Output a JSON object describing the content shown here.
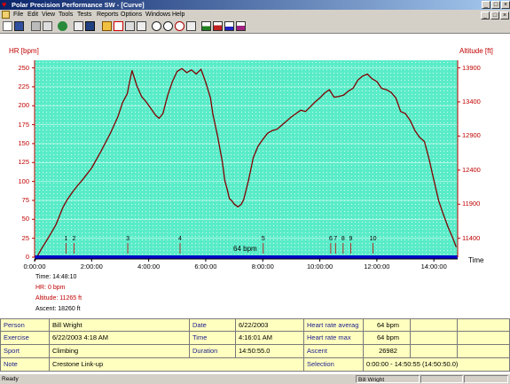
{
  "window": {
    "title": "Polar Precision Performance SW - [Curve]"
  },
  "menu": [
    "File",
    "Edit",
    "View",
    "Tools",
    "Tests",
    "Reports",
    "Options",
    "Windows",
    "Help"
  ],
  "colors": {
    "accent_red": "#c00000",
    "chart_bg": "#60f0d0",
    "blue_bar": "#0000c8",
    "table_bg": "#ffffc0"
  },
  "toolbar": [
    "new-icon",
    "save-icon",
    "print-icon",
    "print-preview-icon",
    "globe-icon",
    "calendar-icon",
    "book-icon",
    "folder-icon",
    "chart-icon",
    "calc-icon",
    "list-icon",
    "zoom-in-icon",
    "zoom-out-icon",
    "zoom-reset-icon",
    "bar-chart-1-icon",
    "bar-chart-2-icon",
    "bar-chart-3-icon",
    "bar-chart-4-icon"
  ],
  "chart_data": {
    "type": "line",
    "ylabel_left": "HR [bpm]",
    "ylabel_right": "Altitude [ft]",
    "xlabel": "Time",
    "hr_ticks": [
      0,
      25,
      50,
      75,
      100,
      125,
      150,
      175,
      200,
      225,
      250
    ],
    "altitude_ticks": [
      11400,
      11900,
      12400,
      12900,
      13400,
      13900
    ],
    "time_ticks": [
      "0:00:00",
      "2:00:00",
      "4:00:00",
      "6:00:00",
      "8:00:00",
      "10:00:00",
      "12:00:00",
      "14:00:00"
    ],
    "ylim_hr": [
      0,
      260
    ],
    "xlim_minutes": [
      0,
      890
    ],
    "baseline_label": "64 bpm",
    "lap_markers": [
      {
        "label": "1",
        "minutes": 66
      },
      {
        "label": "2",
        "minutes": 83
      },
      {
        "label": "3",
        "minutes": 196
      },
      {
        "label": "4",
        "minutes": 306
      },
      {
        "label": "5",
        "minutes": 481
      },
      {
        "label": "6",
        "minutes": 623
      },
      {
        "label": "7",
        "minutes": 633
      },
      {
        "label": "8",
        "minutes": 649
      },
      {
        "label": "9",
        "minutes": 665
      },
      {
        "label": "10",
        "minutes": 712
      }
    ],
    "series": [
      {
        "name": "Altitude",
        "x_minutes": [
          0,
          15,
          30,
          45,
          60,
          70,
          80,
          90,
          100,
          120,
          140,
          160,
          175,
          185,
          195,
          200,
          205,
          215,
          225,
          235,
          245,
          255,
          262,
          270,
          280,
          290,
          300,
          310,
          320,
          330,
          340,
          350,
          360,
          370,
          375,
          385,
          395,
          400,
          405,
          410,
          415,
          420,
          428,
          435,
          440,
          450,
          460,
          470,
          480,
          490,
          500,
          510,
          520,
          530,
          540,
          550,
          560,
          570,
          580,
          590,
          600,
          610,
          620,
          630,
          640,
          650,
          660,
          670,
          680,
          690,
          700,
          710,
          720,
          730,
          740,
          750,
          760,
          770,
          780,
          790,
          800,
          810,
          820,
          830,
          840,
          850,
          860,
          870,
          880,
          887
        ],
        "values_ft": [
          11065,
          11250,
          11420,
          11600,
          11860,
          11980,
          12080,
          12170,
          12250,
          12430,
          12680,
          12950,
          13180,
          13390,
          13520,
          13700,
          13860,
          13640,
          13480,
          13400,
          13300,
          13200,
          13160,
          13230,
          13500,
          13700,
          13850,
          13890,
          13830,
          13870,
          13810,
          13880,
          13690,
          13460,
          13220,
          12900,
          12520,
          12250,
          12120,
          11980,
          11950,
          11900,
          11860,
          11900,
          11970,
          12250,
          12580,
          12750,
          12850,
          12940,
          12980,
          13000,
          13060,
          13120,
          13180,
          13230,
          13280,
          13260,
          13330,
          13400,
          13460,
          13530,
          13580,
          13470,
          13480,
          13500,
          13560,
          13600,
          13720,
          13780,
          13810,
          13740,
          13700,
          13600,
          13580,
          13540,
          13460,
          13260,
          13230,
          13130,
          12980,
          12880,
          12820,
          12560,
          12250,
          11950,
          11750,
          11560,
          11400,
          11270
        ]
      }
    ]
  },
  "cursor_info": {
    "time": "Time: 14:48:10",
    "hr": "HR: 0 bpm",
    "altitude": "Altitude: 11265 ft",
    "ascent": "Ascent: 18260 ft"
  },
  "table": {
    "person_label": "Person",
    "person": "Bill Wright",
    "exercise_label": "Exercise",
    "exercise": "6/22/2003 4:18 AM",
    "sport_label": "Sport",
    "sport": "Climbing",
    "note_label": "Note",
    "note": "Crestone Link-up",
    "date_label": "Date",
    "date": "6/22/2003",
    "time_label": "Time",
    "time": "4:16:01 AM",
    "duration_label": "Duration",
    "duration": "14:50:55.0",
    "hr_avg_label": "Heart rate averag",
    "hr_avg": "64 bpm",
    "hr_max_label": "Heart rate max",
    "hr_max": "64 bpm",
    "ascent_label": "Ascent",
    "ascent": "26982",
    "selection_label": "Selection",
    "selection": "0:00:00 - 14:50:55 (14:50:50.0)"
  },
  "status": {
    "left": "Ready",
    "user": "Bill Wright"
  }
}
